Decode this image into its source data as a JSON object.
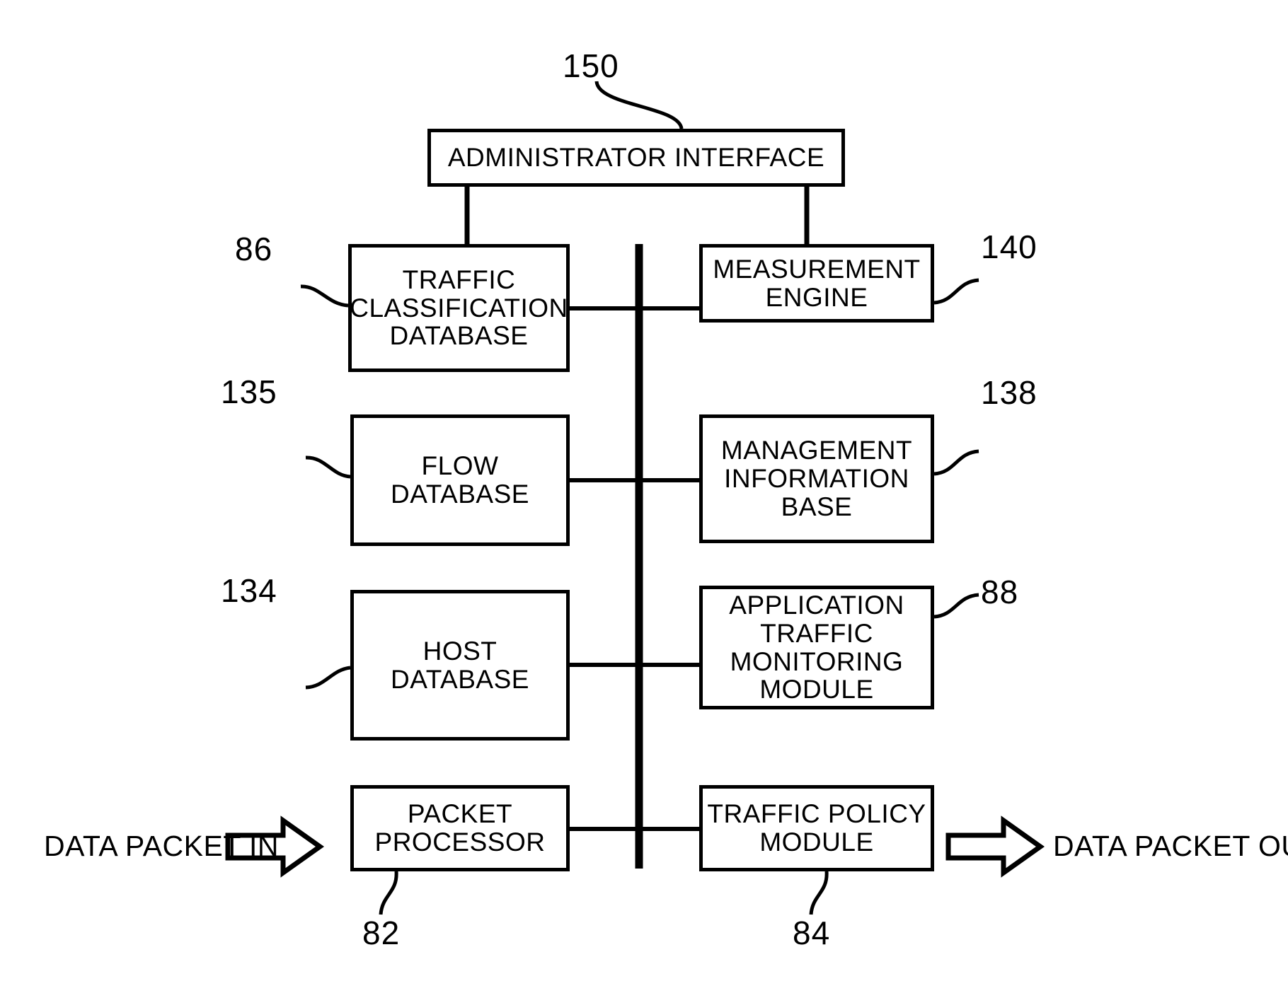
{
  "figure": {
    "type": "patent-block-diagram",
    "background_color": "#ffffff",
    "line_color": "#000000"
  },
  "nodes": {
    "administrator_interface": {
      "label": "ADMINISTRATOR INTERFACE",
      "ref": "150"
    },
    "traffic_classification_database": {
      "label": "TRAFFIC\nCLASSIFICATION\nDATABASE",
      "ref": "86"
    },
    "measurement_engine": {
      "label": "MEASUREMENT\nENGINE",
      "ref": "140"
    },
    "flow_database": {
      "label": "FLOW\nDATABASE",
      "ref": "135"
    },
    "management_information_base": {
      "label": "MANAGEMENT\nINFORMATION\nBASE",
      "ref": "138"
    },
    "host_database": {
      "label": "HOST\nDATABASE",
      "ref": "134"
    },
    "application_traffic_monitoring_module": {
      "label": "APPLICATION\nTRAFFIC\nMONITORING\nMODULE",
      "ref": "88"
    },
    "packet_processor": {
      "label": "PACKET\nPROCESSOR",
      "ref": "82"
    },
    "traffic_policy_module": {
      "label": "TRAFFIC POLICY\nMODULE",
      "ref": "84"
    }
  },
  "io": {
    "packet_in_label": "DATA PACKET IN",
    "packet_out_label": "DATA PACKET OUT"
  },
  "reference_numerals": {
    "admin_interface": "150",
    "traffic_classification_database": "86",
    "measurement_engine": "140",
    "flow_database": "135",
    "management_information_base": "138",
    "host_database": "134",
    "application_traffic_monitoring_module": "88",
    "packet_processor": "82",
    "traffic_policy_module": "84"
  }
}
